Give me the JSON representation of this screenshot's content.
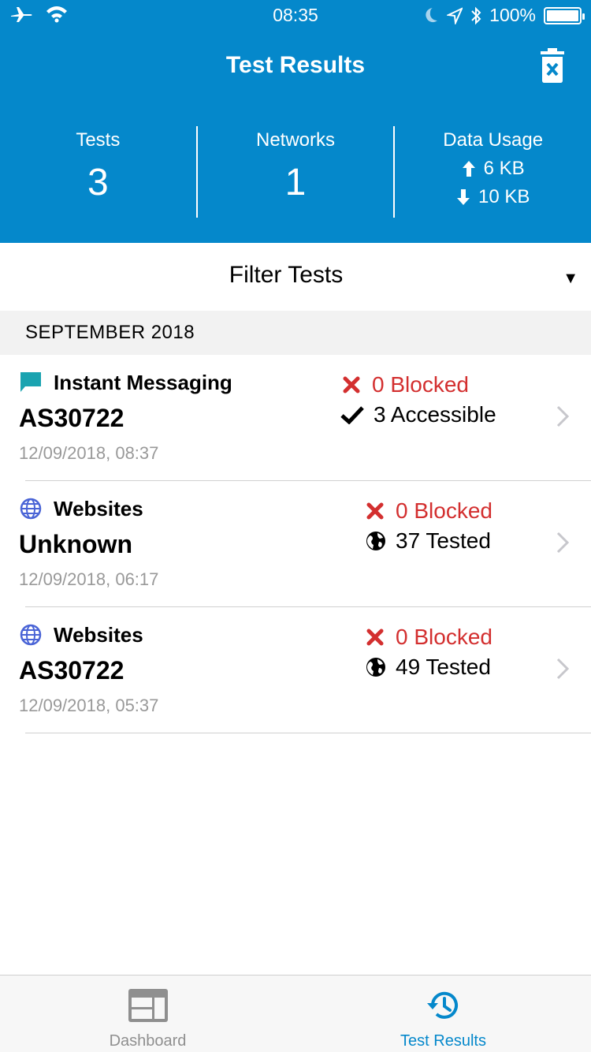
{
  "status_bar": {
    "time": "08:35",
    "battery": "100%"
  },
  "header": {
    "title": "Test Results"
  },
  "stats": {
    "tests_label": "Tests",
    "tests_value": "3",
    "networks_label": "Networks",
    "networks_value": "1",
    "data_usage_label": "Data Usage",
    "upload": "6 KB",
    "download": "10 KB"
  },
  "filter": {
    "label": "Filter Tests"
  },
  "section": {
    "label": "SEPTEMBER 2018"
  },
  "rows": [
    {
      "type": "Instant Messaging",
      "icon": "chat-bubble-icon",
      "network": "AS30722",
      "date": "12/09/2018, 08:37",
      "blocked": "0 Blocked",
      "secondary": "3 Accessible",
      "secondary_icon": "check-icon"
    },
    {
      "type": "Websites",
      "icon": "globe-icon",
      "network": "Unknown",
      "date": "12/09/2018, 06:17",
      "blocked": "0 Blocked",
      "secondary": "37 Tested",
      "secondary_icon": "earth-icon"
    },
    {
      "type": "Websites",
      "icon": "globe-icon",
      "network": "AS30722",
      "date": "12/09/2018, 05:37",
      "blocked": "0 Blocked",
      "secondary": "49 Tested",
      "secondary_icon": "earth-icon"
    }
  ],
  "tabbar": {
    "dashboard_label": "Dashboard",
    "results_label": "Test Results"
  },
  "colors": {
    "brand_blue": "#0588cb",
    "blocked_red": "#d32f2f",
    "im_teal": "#1aa3b0",
    "web_blue": "#4a64d6"
  }
}
